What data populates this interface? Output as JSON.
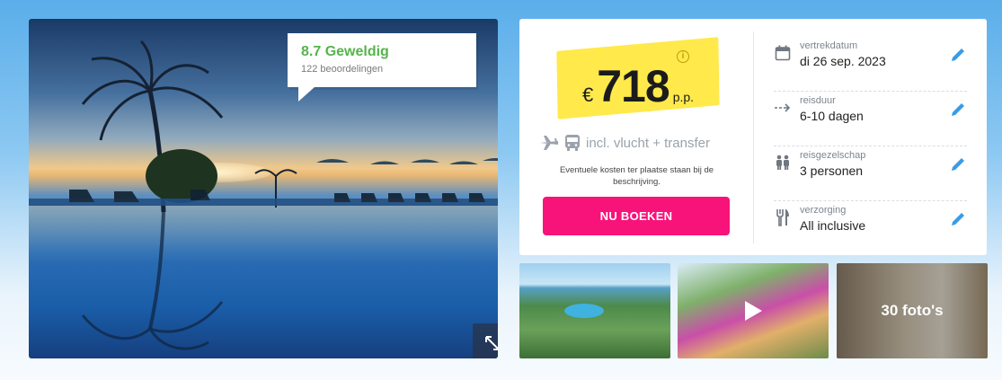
{
  "rating": {
    "score": "8.7 Geweldig",
    "count": "122 beoordelingen"
  },
  "price": {
    "currency": "€",
    "amount": "718",
    "per": "p.p.",
    "info": "i"
  },
  "includes": "incl. vlucht + transfer",
  "note": "Eventuele kosten ter plaatse staan bij de beschrijving.",
  "book_label": "NU BOEKEN",
  "details": [
    {
      "label": "vertrekdatum",
      "value": "di 26 sep. 2023",
      "icon": "calendar-icon"
    },
    {
      "label": "reisduur",
      "value": "6-10 dagen",
      "icon": "duration-arrow-icon"
    },
    {
      "label": "reisgezelschap",
      "value": "3 personen",
      "icon": "people-icon"
    },
    {
      "label": "verzorging",
      "value": "All inclusive",
      "icon": "cutlery-icon"
    }
  ],
  "photos_label": "30 foto's",
  "colors": {
    "accent": "#f8137b",
    "rating": "#55b44a",
    "highlight": "#ffe94b",
    "edit": "#3a9be6"
  }
}
